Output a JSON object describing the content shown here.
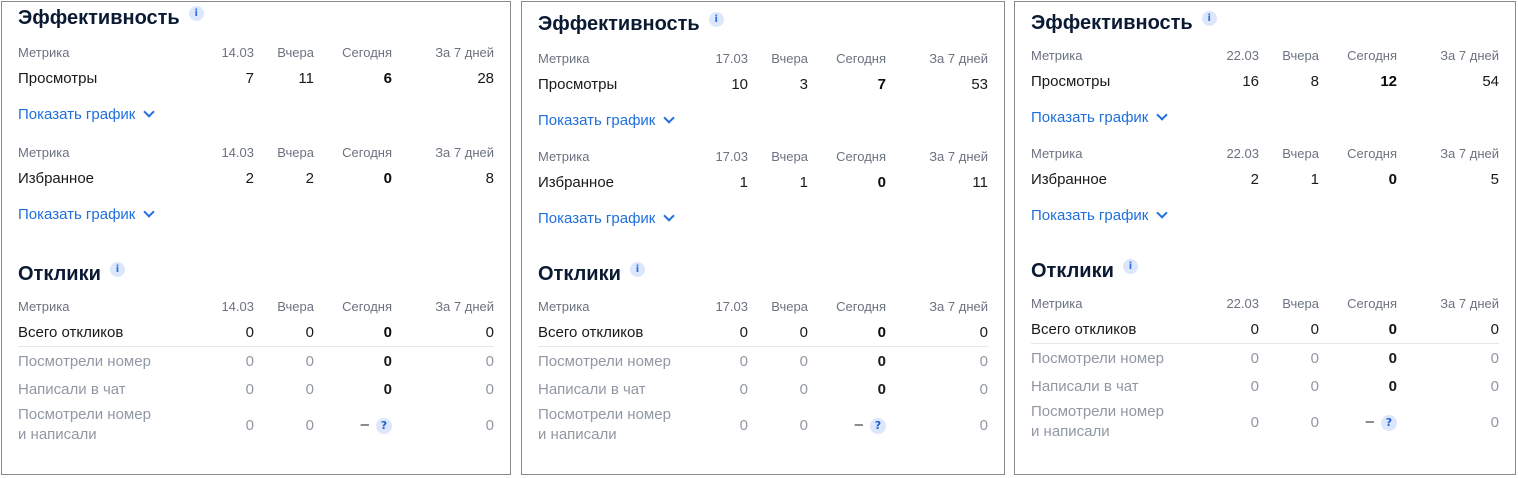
{
  "panels": [
    {
      "efficiency": {
        "title": "Эффективность",
        "headers": [
          "Метрика",
          "14.03",
          "Вчера",
          "Сегодня",
          "За 7 дней"
        ],
        "views": {
          "name": "Просмотры",
          "values": [
            "7",
            "11",
            "6",
            "28"
          ]
        },
        "favorites": {
          "name": "Избранное",
          "values": [
            "2",
            "2",
            "0",
            "8"
          ]
        },
        "show_chart": "Показать график"
      },
      "responses": {
        "title": "Отклики",
        "headers": [
          "Метрика",
          "14.03",
          "Вчера",
          "Сегодня",
          "За 7 дней"
        ],
        "total": {
          "name": "Всего откликов",
          "values": [
            "0",
            "0",
            "0",
            "0"
          ]
        },
        "viewed_number": {
          "name": "Посмотрели номер",
          "values": [
            "0",
            "0",
            "0",
            "0"
          ]
        },
        "wrote_chat": {
          "name": "Написали в чат",
          "values": [
            "0",
            "0",
            "0",
            "0"
          ]
        },
        "viewed_and_wrote": {
          "name_line1": "Посмотрели номер",
          "name_line2": "и написали",
          "values": [
            "0",
            "0",
            "–",
            "0"
          ]
        }
      }
    },
    {
      "efficiency": {
        "title": "Эффективность",
        "headers": [
          "Метрика",
          "17.03",
          "Вчера",
          "Сегодня",
          "За 7 дней"
        ],
        "views": {
          "name": "Просмотры",
          "values": [
            "10",
            "3",
            "7",
            "53"
          ]
        },
        "favorites": {
          "name": "Избранное",
          "values": [
            "1",
            "1",
            "0",
            "11"
          ]
        },
        "show_chart": "Показать график"
      },
      "responses": {
        "title": "Отклики",
        "headers": [
          "Метрика",
          "17.03",
          "Вчера",
          "Сегодня",
          "За 7 дней"
        ],
        "total": {
          "name": "Всего откликов",
          "values": [
            "0",
            "0",
            "0",
            "0"
          ]
        },
        "viewed_number": {
          "name": "Посмотрели номер",
          "values": [
            "0",
            "0",
            "0",
            "0"
          ]
        },
        "wrote_chat": {
          "name": "Написали в чат",
          "values": [
            "0",
            "0",
            "0",
            "0"
          ]
        },
        "viewed_and_wrote": {
          "name_line1": "Посмотрели номер",
          "name_line2": "и написали",
          "values": [
            "0",
            "0",
            "–",
            "0"
          ]
        }
      }
    },
    {
      "efficiency": {
        "title": "Эффективность",
        "headers": [
          "Метрика",
          "22.03",
          "Вчера",
          "Сегодня",
          "За 7 дней"
        ],
        "views": {
          "name": "Просмотры",
          "values": [
            "16",
            "8",
            "12",
            "54"
          ]
        },
        "favorites": {
          "name": "Избранное",
          "values": [
            "2",
            "1",
            "0",
            "5"
          ]
        },
        "show_chart": "Показать график"
      },
      "responses": {
        "title": "Отклики",
        "headers": [
          "Метрика",
          "22.03",
          "Вчера",
          "Сегодня",
          "За 7 дней"
        ],
        "total": {
          "name": "Всего откликов",
          "values": [
            "0",
            "0",
            "0",
            "0"
          ]
        },
        "viewed_number": {
          "name": "Посмотрели номер",
          "values": [
            "0",
            "0",
            "0",
            "0"
          ]
        },
        "wrote_chat": {
          "name": "Написали в чат",
          "values": [
            "0",
            "0",
            "0",
            "0"
          ]
        },
        "viewed_and_wrote": {
          "name_line1": "Посмотрели номер",
          "name_line2": "и написали",
          "values": [
            "0",
            "0",
            "–",
            "0"
          ]
        }
      }
    }
  ],
  "icons": {
    "info": "i",
    "help": "?"
  },
  "colors": {
    "link": "#1f6fdc",
    "muted": "#9098a3",
    "badge_bg": "#dce7fb"
  }
}
